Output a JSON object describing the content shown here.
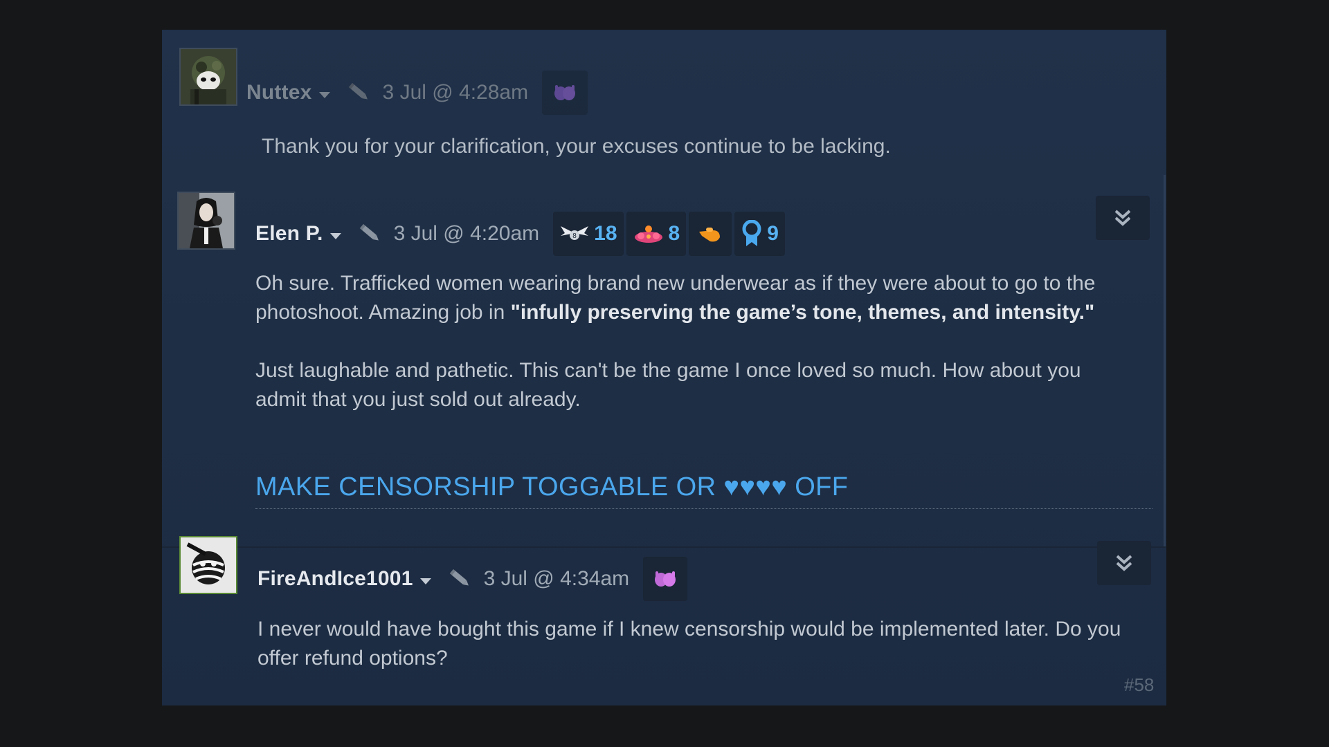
{
  "comments": [
    {
      "author": "Nuttex",
      "time": "3 Jul @ 4:28am",
      "award_icon": "purple-hands-award-icon",
      "text": "Thank you for your clarification, your excuses continue to be lacking."
    },
    {
      "author": "Elen P.",
      "time": "3 Jul @ 4:20am",
      "awards": [
        {
          "icon": "winged-award-icon",
          "count": "18"
        },
        {
          "icon": "clown-award-icon",
          "count": "8"
        },
        {
          "icon": "hand-award-icon",
          "count": ""
        },
        {
          "icon": "ribbon-award-icon",
          "count": "9"
        }
      ],
      "text_line1": "Oh sure. Trafficked women wearing brand new underwear as if they were about to go to the",
      "text_line2_prefix": "photoshoot. Amazing job in ",
      "text_line2_bold": "\"infully preserving the game’s tone, themes, and intensity.\"",
      "text_para2": "Just laughable and pathetic. This can't be the game I once loved so much. How about you admit that you just sold out already.",
      "link_text": "MAKE CENSORSHIP TOGGABLE OR ♥♥♥♥ OFF"
    },
    {
      "author": "FireAndIce1001",
      "time": "3 Jul @ 4:34am",
      "award_icon": "purple-hands-award-icon",
      "text": "I never would have bought this game if I knew censorship would be implemented later. Do you offer refund options?",
      "post_number": "#58"
    }
  ],
  "colors": {
    "background": "#161719",
    "panel": "#1e2e44",
    "link": "#4ba7ed",
    "badge_count": "#58b2f2",
    "award_purple": "#a066e0"
  }
}
